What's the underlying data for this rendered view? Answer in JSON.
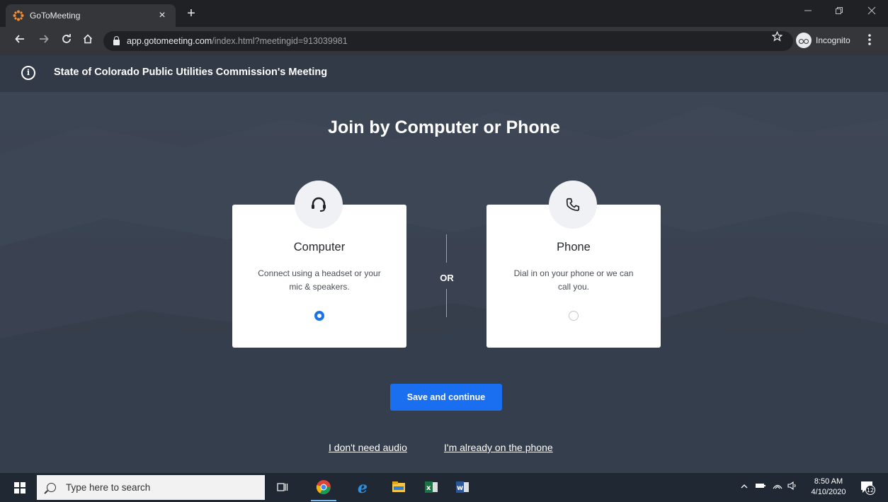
{
  "browser": {
    "tab_title": "GoToMeeting",
    "tab_close": "×",
    "new_tab": "+",
    "url_host": "app.gotomeeting.com",
    "url_path": "/index.html?meetingid=913039981",
    "incognito_label": "Incognito",
    "icons": [
      "back-icon",
      "forward-icon",
      "reload-icon",
      "home-icon",
      "lock-icon",
      "star-icon",
      "incognito-icon",
      "kebab-menu-icon"
    ]
  },
  "meeting": {
    "title": "State of Colorado Public Utilities Commission's Meeting",
    "info_glyph": "i"
  },
  "join": {
    "heading": "Join by Computer or Phone",
    "or_label": "OR",
    "computer": {
      "title": "Computer",
      "description": "Connect using a headset or your mic & speakers.",
      "selected": true
    },
    "phone": {
      "title": "Phone",
      "description": "Dial in on your phone or we can call you.",
      "selected": false
    },
    "save_button": "Save and continue",
    "no_audio_link": "I don't need audio",
    "already_on_phone_link": "I'm already on the phone"
  },
  "taskbar": {
    "search_placeholder": "Type here to search",
    "time": "8:50 AM",
    "date": "4/10/2020",
    "notification_count": "12"
  },
  "colors": {
    "accent": "#1a6ff0",
    "radio_selected": "#1a73e8",
    "page_bg": "#3a4352"
  }
}
